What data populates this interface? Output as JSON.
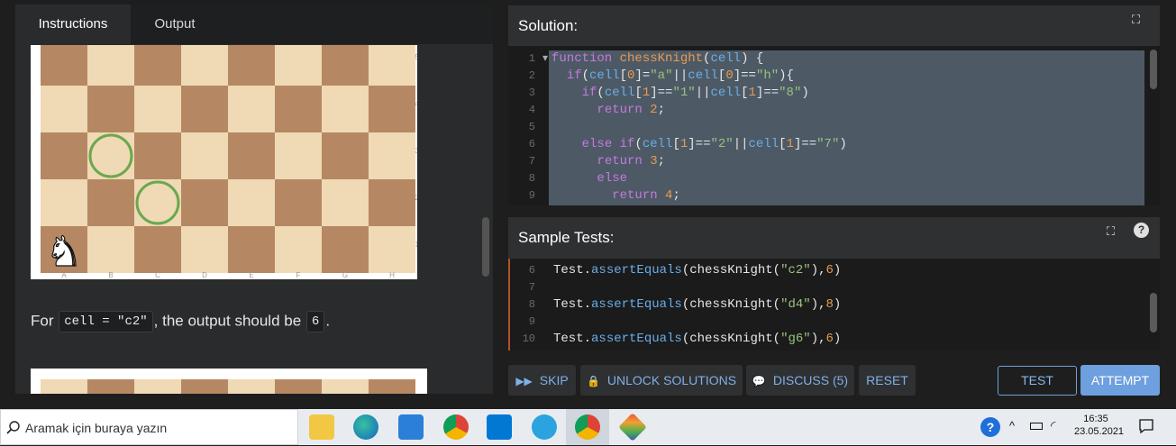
{
  "tabs": [
    {
      "label": "Instructions"
    },
    {
      "label": "Output"
    }
  ],
  "board": {
    "ranks": [
      "5",
      "4",
      "3",
      "2",
      "1"
    ],
    "files": [
      "A",
      "B",
      "C",
      "D",
      "E",
      "F",
      "G",
      "H"
    ],
    "knight_glyph": "♞"
  },
  "description": {
    "prefix": "For ",
    "code": "cell = \"c2\"",
    "middle": ", the output should be ",
    "value": "6",
    "suffix": "."
  },
  "solution": {
    "title": "Solution:",
    "fold_glyph": "▾",
    "lines": [
      {
        "n": "1",
        "t": "function chessKnight(cell) {"
      },
      {
        "n": "2",
        "t": "  if(cell[0]=\"a\"||cell[0]==\"h\"){"
      },
      {
        "n": "3",
        "t": "    if(cell[1]==\"1\"||cell[1]==\"8\")"
      },
      {
        "n": "4",
        "t": "      return 2;"
      },
      {
        "n": "5",
        "t": ""
      },
      {
        "n": "6",
        "t": "    else if(cell[1]==\"2\"||cell[1]==\"7\")"
      },
      {
        "n": "7",
        "t": "      return 3;"
      },
      {
        "n": "8",
        "t": "      else"
      },
      {
        "n": "9",
        "t": "        return 4;"
      }
    ]
  },
  "sample_tests": {
    "title": "Sample Tests:",
    "lines": [
      {
        "n": "6",
        "t": "Test.assertEquals(chessKnight(\"c2\"),6)"
      },
      {
        "n": "7",
        "t": ""
      },
      {
        "n": "8",
        "t": "Test.assertEquals(chessKnight(\"d4\"),8)"
      },
      {
        "n": "9",
        "t": ""
      },
      {
        "n": "10",
        "t": "Test.assertEquals(chessKnight(\"g6\"),6)"
      }
    ]
  },
  "buttons": {
    "skip": "SKIP",
    "unlock": "UNLOCK SOLUTIONS",
    "discuss": "DISCUSS (5)",
    "reset": "RESET",
    "test": "TEST",
    "attempt": "ATTEMPT"
  },
  "taskbar": {
    "search_placeholder": "Aramak için buraya yazın",
    "time": "16:35",
    "date": "23.05.2021",
    "apps": [
      "file-explorer",
      "edge",
      "store",
      "chrome",
      "vscode",
      "telegram",
      "chrome-active",
      "git"
    ]
  },
  "colors": {
    "light_square": "#f0d9b5",
    "dark_square": "#b58863",
    "accent": "#6e9fde",
    "circle": "#6aa84f"
  }
}
